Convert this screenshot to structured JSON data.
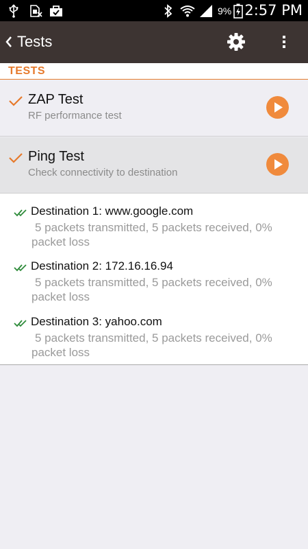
{
  "status_bar": {
    "battery_percent": "9%",
    "time": "2:57 PM",
    "icons": [
      "usb-icon",
      "sim-icon",
      "bag-icon",
      "bluetooth-icon",
      "wifi-icon",
      "signal-icon",
      "battery-charging-icon"
    ]
  },
  "action_bar": {
    "back_icon": "chevron-left-icon",
    "title": "Tests",
    "settings_icon": "gear-icon",
    "overflow_icon": "overflow-menu-icon"
  },
  "section": {
    "title": "TESTS"
  },
  "tests": [
    {
      "name": "ZAP Test",
      "description": "RF performance test",
      "status_icon": "check-icon",
      "action_icon": "play-icon"
    },
    {
      "name": "Ping Test",
      "description": "Check connectivity to destination",
      "status_icon": "check-icon",
      "action_icon": "play-icon"
    }
  ],
  "results": [
    {
      "title": "Destination 1: www.google.com",
      "detail": "5 packets transmitted, 5 packets received, 0% packet loss"
    },
    {
      "title": "Destination 2: 172.16.16.94",
      "detail": "5 packets transmitted, 5 packets received, 0% packet loss"
    },
    {
      "title": "Destination 3: yahoo.com",
      "detail": "5 packets transmitted, 5 packets received, 0% packet loss"
    }
  ],
  "colors": {
    "accent": "#e6792b",
    "play_button": "#f08a3c",
    "action_bar": "#3d3432",
    "success": "#2e8b3a"
  }
}
